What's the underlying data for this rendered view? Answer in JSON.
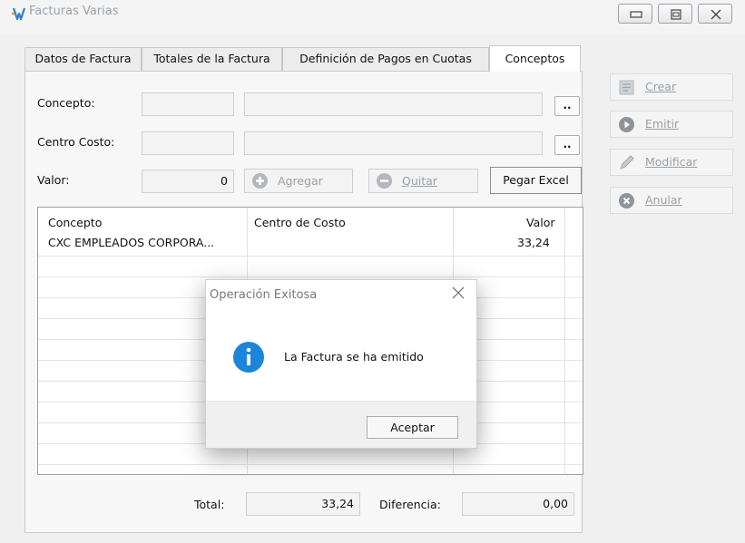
{
  "window": {
    "title": "Facturas Varias"
  },
  "tabs": [
    {
      "label": "Datos de Factura"
    },
    {
      "label": "Totales de la Factura"
    },
    {
      "label": "Definición de Pagos en Cuotas"
    },
    {
      "label": "Conceptos",
      "active": true
    }
  ],
  "form": {
    "concepto_label": "Concepto:",
    "centro_label": "Centro Costo:",
    "valor_label": "Valor:",
    "valor_value": "0",
    "dots": "..",
    "agregar_label": "Agregar",
    "quitar_label": "Quitar",
    "pegar_label": "Pegar Excel"
  },
  "table": {
    "headers": [
      "Concepto",
      "Centro de Costo",
      "Valor"
    ],
    "rows": [
      {
        "concepto": "CXC EMPLEADOS CORPORA...",
        "centro": "",
        "valor": "33,24"
      }
    ]
  },
  "totals": {
    "total_label": "Total:",
    "total_value": "33,24",
    "diferencia_label": "Diferencia:",
    "diferencia_value": "0,00"
  },
  "side_actions": {
    "crear": "Crear",
    "emitir": "Emitir",
    "modificar": "Modificar",
    "anular": "Anular"
  },
  "dialog": {
    "title": "Operación Exitosa",
    "message": "La Factura se ha emitido",
    "ok_label": "Aceptar"
  },
  "colors": {
    "info_blue": "#1b86d8",
    "disabled_text": "#9aa0a6"
  }
}
